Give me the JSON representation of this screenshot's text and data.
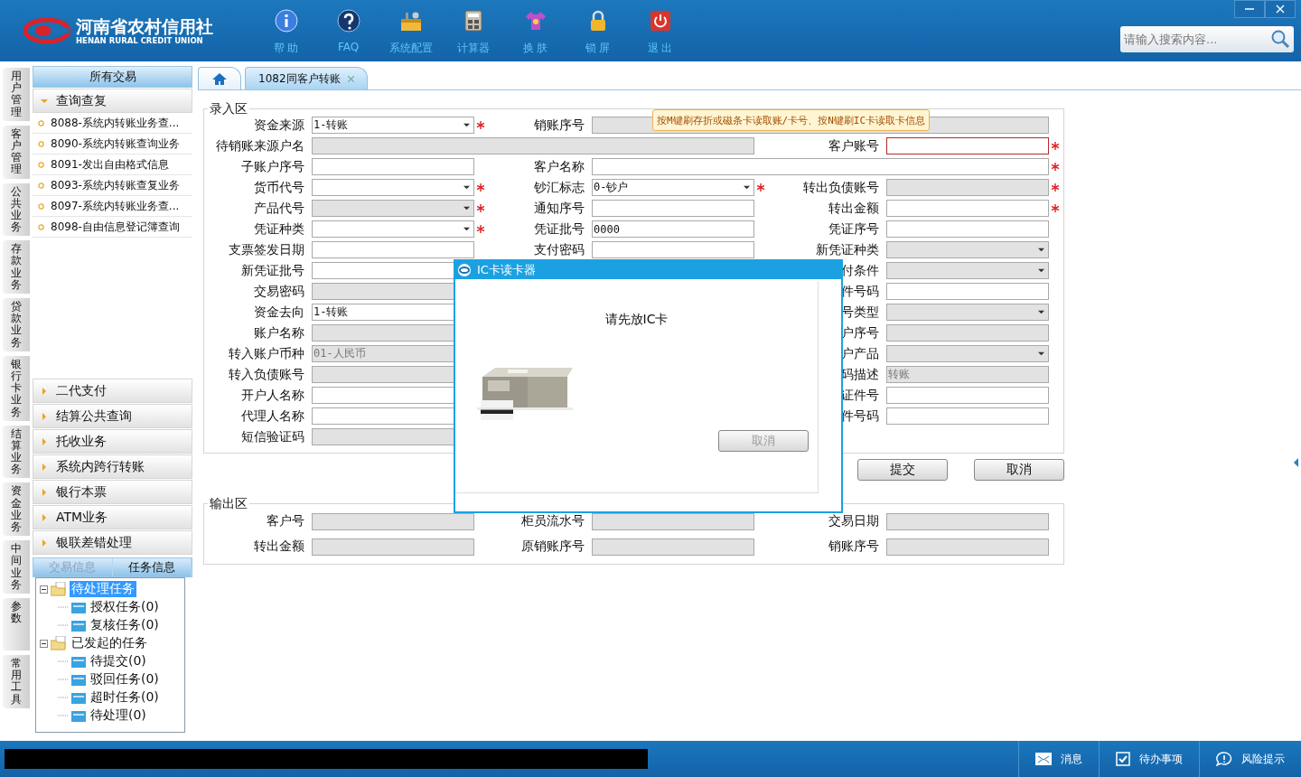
{
  "header": {
    "logo_title": "河南省农村信用社",
    "logo_subtitle": "HENAN RURAL CREDIT UNION",
    "toolbar": [
      {
        "kind": "info",
        "label": "帮 助"
      },
      {
        "kind": "faq",
        "label": "FAQ"
      },
      {
        "kind": "config",
        "label": "系统配置"
      },
      {
        "kind": "calculator",
        "label": "计算器"
      },
      {
        "kind": "skin",
        "label": "换 肤"
      },
      {
        "kind": "lock",
        "label": "锁 屏"
      },
      {
        "kind": "exit",
        "label": "退 出"
      }
    ],
    "search": {
      "placeholder": "请输入搜索内容..."
    }
  },
  "side_tabs": [
    "用户管理",
    "客户管理",
    "公共业务",
    "存款业务",
    "贷款业务",
    "银行卡业务",
    "结算业务",
    "资金业务",
    "中间业务",
    "参数",
    "常用工具"
  ],
  "nav": {
    "title": "所有交易",
    "groups": [
      {
        "label": "查询查复",
        "expanded": true,
        "items": [
          "8088-系统内转账业务查...",
          "8090-系统内转账查询业务",
          "8091-发出自由格式信息",
          "8093-系统内转账查复业务",
          "8097-系统内转账业务查...",
          "8098-自由信息登记簿查询"
        ]
      },
      {
        "label": "二代支付",
        "expanded": false
      },
      {
        "label": "结算公共查询",
        "expanded": false
      },
      {
        "label": "托收业务",
        "expanded": false
      },
      {
        "label": "系统内跨行转账",
        "expanded": false
      },
      {
        "label": "银行本票",
        "expanded": false
      },
      {
        "label": "ATM业务",
        "expanded": false
      },
      {
        "label": "银联差错处理",
        "expanded": false
      }
    ]
  },
  "task_tabs": [
    {
      "label": "交易信息",
      "selected": false
    },
    {
      "label": "任务信息",
      "selected": true
    }
  ],
  "task_tree": [
    {
      "label": "待处理任务",
      "selected": true,
      "expanded": true,
      "children": [
        {
          "label": "授权任务(0)",
          "selected": false
        },
        {
          "label": "复核任务(0)",
          "selected": false
        }
      ]
    },
    {
      "label": "已发起的任务",
      "selected": false,
      "expanded": true,
      "children": [
        {
          "label": "待提交(0)",
          "selected": false
        },
        {
          "label": "驳回任务(0)",
          "selected": false
        },
        {
          "label": "超时任务(0)",
          "selected": false
        },
        {
          "label": "待处理(0)",
          "selected": false
        }
      ]
    }
  ],
  "tabs": [
    {
      "kind": "home",
      "selected": false
    },
    {
      "kind": "page",
      "label": "1082同客户转账",
      "selected": true
    }
  ],
  "entry": {
    "title": "录入区",
    "tooltip": "按M键刷存折或磁条卡读取账/卡号、按N键刷IC卡读取卡信息",
    "rows": [
      {
        "left": {
          "label": "资金来源",
          "kind": "select",
          "value": "1-转账",
          "disabled": false,
          "required": true,
          "error": false
        },
        "middle": {
          "label": "销账序号",
          "kind": "text",
          "disabled": true,
          "required": false,
          "error": false,
          "wide": true
        }
      },
      {
        "left": {
          "label": "待销账来源户名",
          "kind": "text",
          "disabled": true,
          "required": false,
          "error": false,
          "wide": true
        },
        "right": {
          "label": "客户账号",
          "kind": "text",
          "disabled": false,
          "required": true,
          "error": true
        }
      },
      {
        "left": {
          "label": "子账户序号",
          "kind": "text",
          "disabled": false,
          "required": false,
          "error": false
        },
        "middle": {
          "label": "客户名称",
          "kind": "text",
          "disabled": false,
          "required": true,
          "error": false,
          "wide": true
        }
      },
      {
        "left": {
          "label": "货币代号",
          "kind": "select",
          "disabled": false,
          "required": true,
          "error": false
        },
        "middle": {
          "label": "钞汇标志",
          "kind": "select",
          "value": "0-钞户",
          "disabled": false,
          "required": true,
          "error": false
        },
        "right": {
          "label": "转出负债账号",
          "kind": "text",
          "disabled": true,
          "required": true,
          "error": false
        }
      },
      {
        "left": {
          "label": "产品代号",
          "kind": "select",
          "disabled": true,
          "required": true,
          "error": false
        },
        "middle": {
          "label": "通知序号",
          "kind": "text",
          "disabled": false,
          "required": false,
          "error": false
        },
        "right": {
          "label": "转出金额",
          "kind": "text",
          "disabled": false,
          "required": true,
          "error": false
        }
      },
      {
        "left": {
          "label": "凭证种类",
          "kind": "select",
          "disabled": false,
          "required": true,
          "error": false
        },
        "middle": {
          "label": "凭证批号",
          "kind": "text",
          "value": "0000",
          "disabled": false,
          "required": false,
          "error": false
        },
        "right": {
          "label": "凭证序号",
          "kind": "text",
          "disabled": false,
          "required": false,
          "error": false
        }
      },
      {
        "left": {
          "label": "支票签发日期",
          "kind": "text",
          "disabled": false,
          "required": false,
          "error": false
        },
        "middle": {
          "label": "支付密码",
          "kind": "text",
          "disabled": false,
          "required": false,
          "error": false
        },
        "right": {
          "label": "新凭证种类",
          "kind": "select",
          "disabled": true,
          "required": false,
          "error": false
        }
      },
      {
        "left": {
          "label": "新凭证批号",
          "kind": "text",
          "disabled": false,
          "error": false
        },
        "right": {
          "label": "付条件",
          "kind": "select",
          "disabled": true,
          "required": false,
          "error": false
        }
      },
      {
        "left": {
          "label": "交易密码",
          "kind": "text",
          "disabled": true,
          "error": false
        },
        "right": {
          "label": "件号码",
          "kind": "text",
          "disabled": false,
          "required": false,
          "error": false
        }
      },
      {
        "left": {
          "label": "资金去向",
          "kind": "text",
          "value": "1-转账",
          "disabled": false,
          "error": false
        },
        "right": {
          "label": "号类型",
          "kind": "select",
          "disabled": true,
          "required": false,
          "error": false
        }
      },
      {
        "left": {
          "label": "账户名称",
          "kind": "text",
          "disabled": true,
          "error": false
        },
        "right": {
          "label": "户序号",
          "kind": "text",
          "disabled": true,
          "required": false,
          "error": false
        }
      },
      {
        "left": {
          "label": "转入账户币种",
          "kind": "text",
          "value": "01-人民币",
          "disabled": true,
          "error": false
        },
        "right": {
          "label": "户产品",
          "kind": "select",
          "disabled": true,
          "required": false,
          "error": false
        }
      },
      {
        "left": {
          "label": "转入负债账号",
          "kind": "text",
          "disabled": true,
          "error": false
        },
        "right": {
          "label": "码描述",
          "kind": "text",
          "value": "转账",
          "disabled": true,
          "required": false,
          "error": false
        }
      },
      {
        "left": {
          "label": "开户人名称",
          "kind": "text",
          "disabled": false,
          "error": false
        },
        "right": {
          "label": "证件号",
          "kind": "text",
          "disabled": false,
          "required": false,
          "error": false
        }
      },
      {
        "left": {
          "label": "代理人名称",
          "kind": "text",
          "disabled": false,
          "error": false
        },
        "right": {
          "label": "件号码",
          "kind": "text",
          "disabled": false,
          "required": false,
          "error": false
        }
      },
      {
        "left": {
          "label": "短信验证码",
          "kind": "text",
          "disabled": true,
          "error": false
        }
      }
    ]
  },
  "actions": [
    "提交",
    "取消"
  ],
  "output": {
    "title": "输出区",
    "rows": [
      {
        "left": {
          "label": "客户号",
          "kind": "text",
          "disabled": true,
          "required": false,
          "error": false
        },
        "middle": {
          "label": "柜员流水号",
          "kind": "text",
          "disabled": true,
          "required": false,
          "error": false
        },
        "right": {
          "label": "交易日期",
          "kind": "text",
          "disabled": true,
          "required": false,
          "error": false
        }
      },
      {
        "left": {
          "label": "转出金额",
          "kind": "text",
          "disabled": true,
          "required": false,
          "error": false
        },
        "middle": {
          "label": "原销账序号",
          "kind": "text",
          "disabled": true,
          "required": false,
          "error": false
        },
        "right": {
          "label": "销账序号",
          "kind": "text",
          "disabled": true,
          "required": false,
          "error": false
        }
      }
    ]
  },
  "dialog": {
    "title": "IC卡读卡器",
    "message": "请先放IC卡",
    "button": {
      "label": "取消",
      "disabled": true
    }
  },
  "status_bar": {
    "items": [
      {
        "kind": "message",
        "label": "消息"
      },
      {
        "kind": "todo",
        "label": "待办事项"
      },
      {
        "kind": "risk",
        "label": "风险提示"
      }
    ]
  }
}
